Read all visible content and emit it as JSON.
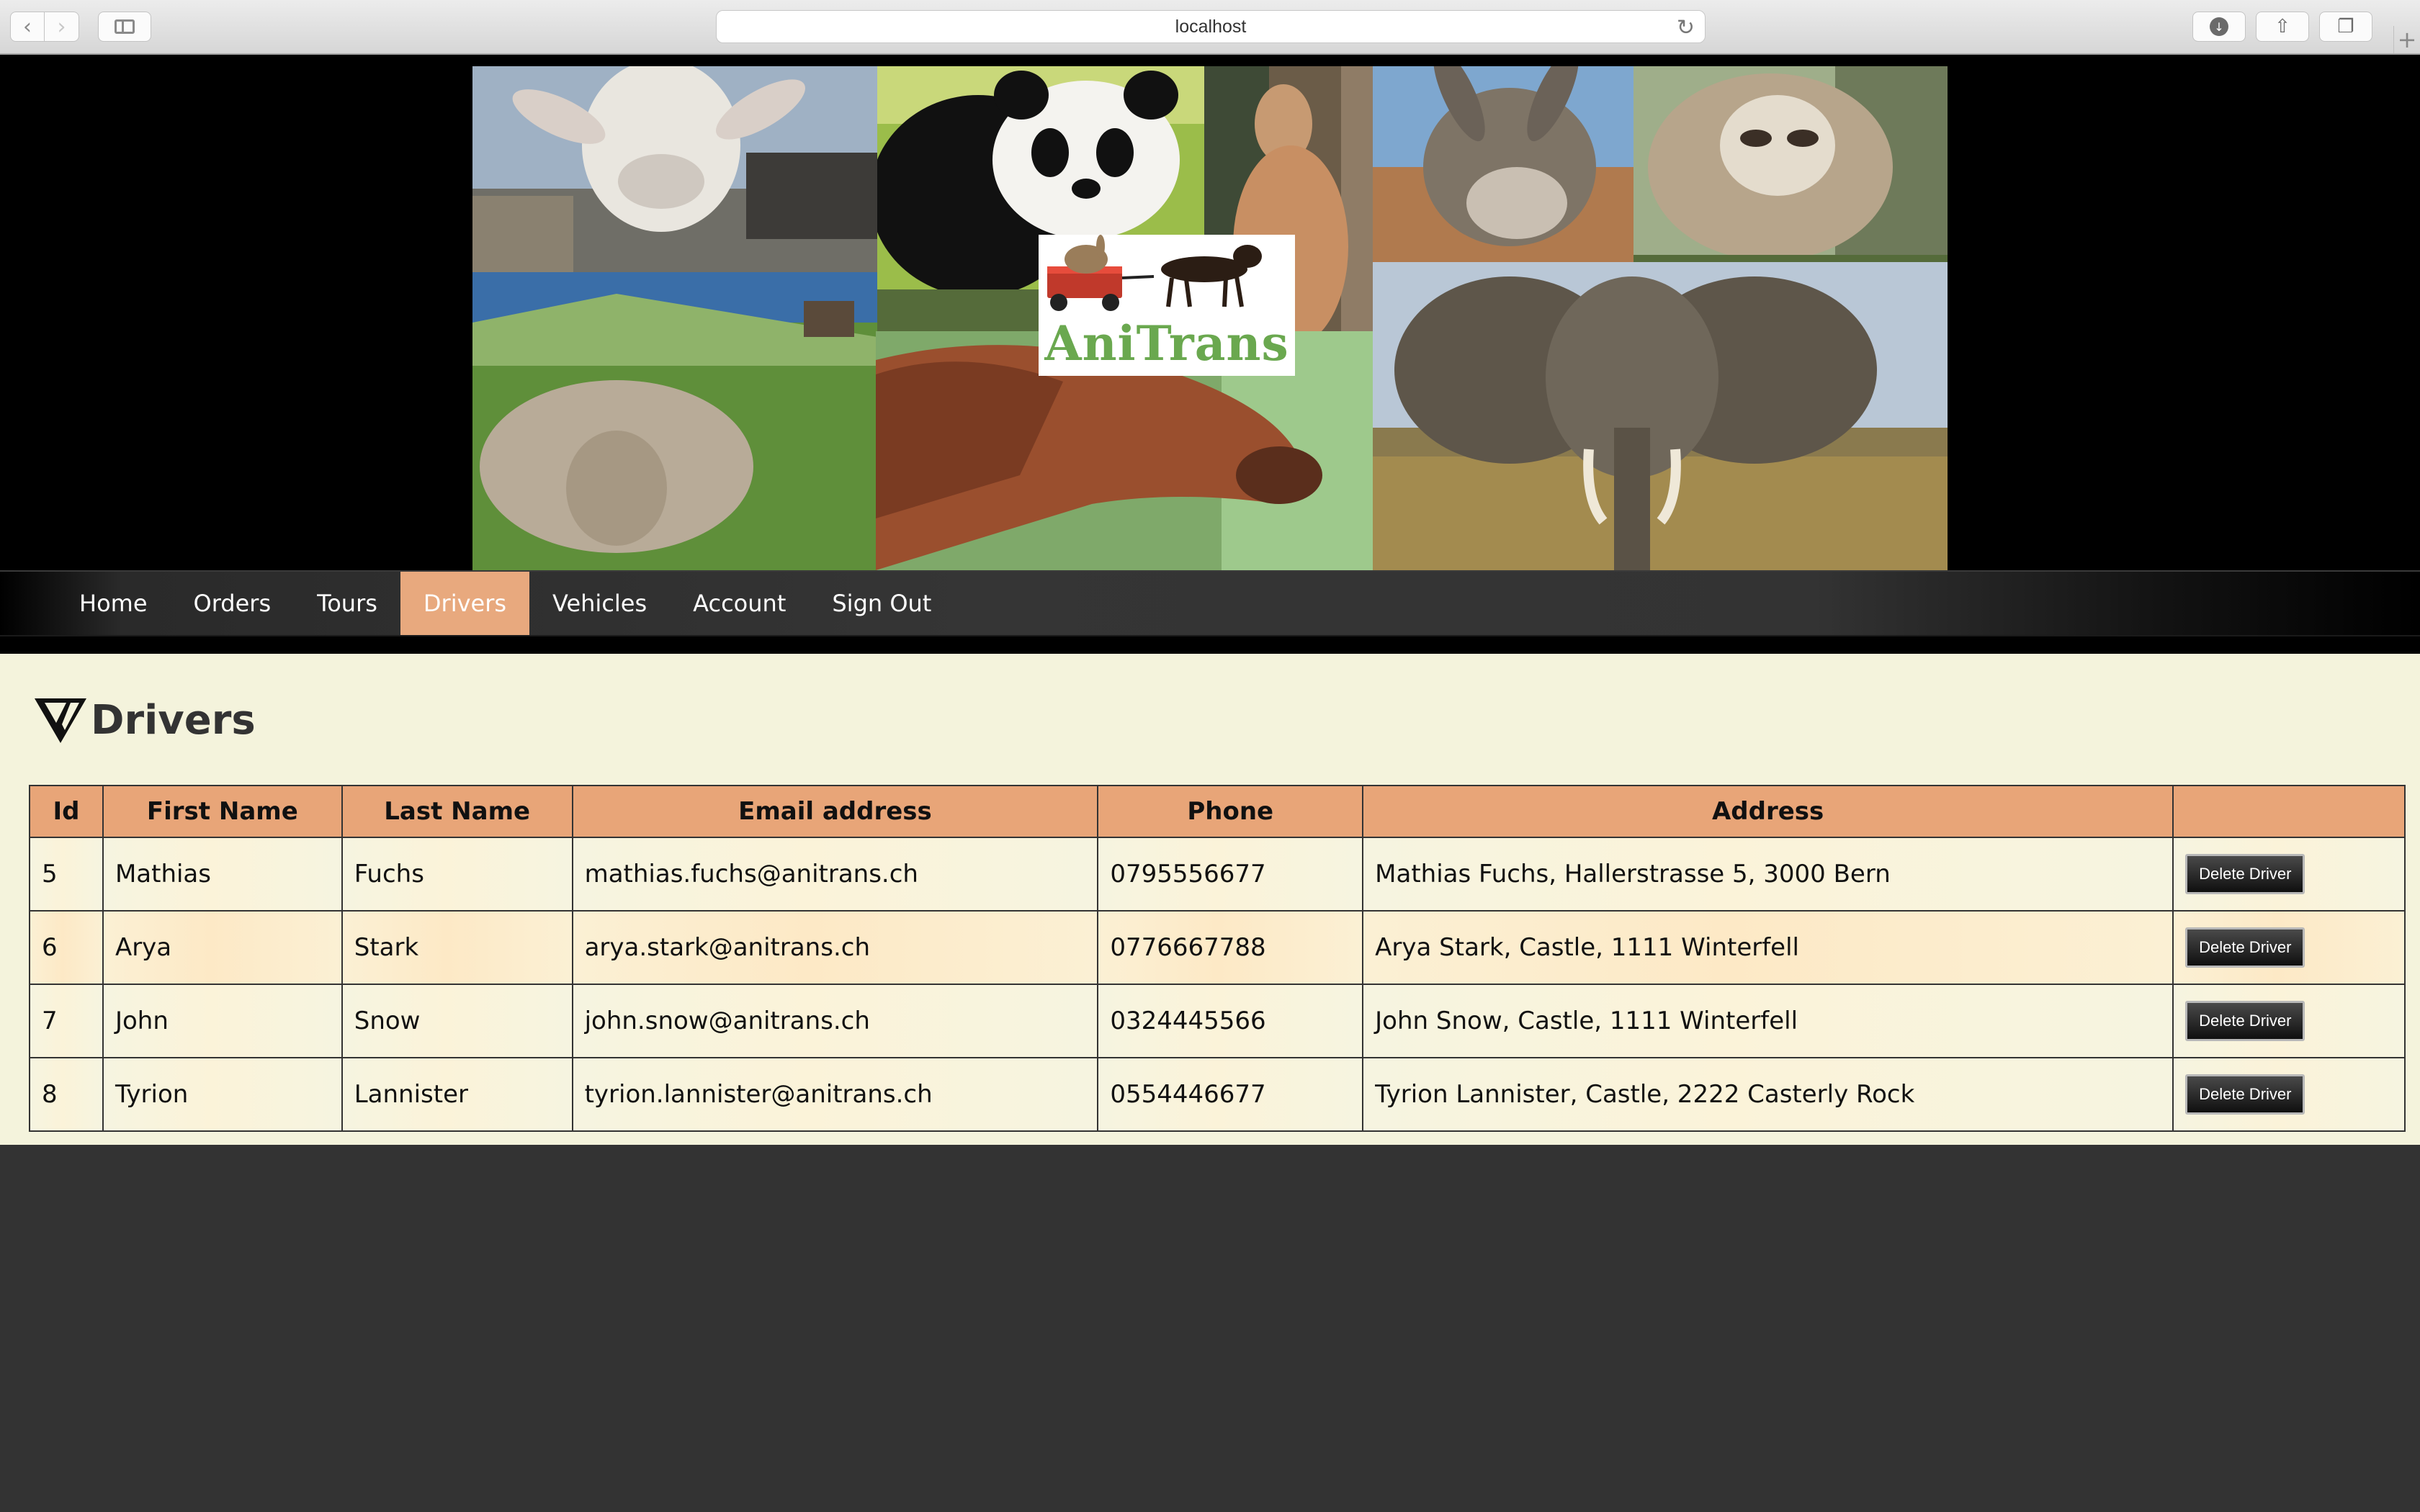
{
  "browser": {
    "url": "localhost"
  },
  "banner": {
    "logo_text": "AniTrans"
  },
  "nav": {
    "items": [
      {
        "label": "Home",
        "active": false
      },
      {
        "label": "Orders",
        "active": false
      },
      {
        "label": "Tours",
        "active": false
      },
      {
        "label": "Drivers",
        "active": true
      },
      {
        "label": "Vehicles",
        "active": false
      },
      {
        "label": "Account",
        "active": false
      },
      {
        "label": "Sign Out",
        "active": false
      }
    ]
  },
  "page": {
    "title": "Drivers"
  },
  "table": {
    "headers": [
      "Id",
      "First Name",
      "Last Name",
      "Email address",
      "Phone",
      "Address",
      ""
    ],
    "rows": [
      {
        "id": "5",
        "first": "Mathias",
        "last": "Fuchs",
        "email": "mathias.fuchs@anitrans.ch",
        "phone": "0795556677",
        "address": "Mathias Fuchs, Hallerstrasse 5, 3000 Bern",
        "action": "Delete Driver"
      },
      {
        "id": "6",
        "first": "Arya",
        "last": "Stark",
        "email": "arya.stark@anitrans.ch",
        "phone": "0776667788",
        "address": "Arya Stark, Castle, 1111 Winterfell",
        "action": "Delete Driver"
      },
      {
        "id": "7",
        "first": "John",
        "last": "Snow",
        "email": "john.snow@anitrans.ch",
        "phone": "0324445566",
        "address": "John Snow, Castle, 1111 Winterfell",
        "action": "Delete Driver"
      },
      {
        "id": "8",
        "first": "Tyrion",
        "last": "Lannister",
        "email": "tyrion.lannister@anitrans.ch",
        "phone": "0554446677",
        "address": "Tyrion Lannister, Castle, 2222 Casterly Rock",
        "action": "Delete Driver"
      }
    ]
  },
  "colors": {
    "accent": "#e8a97e",
    "header_bg": "#e8a578",
    "content_bg": "#f4f3dc",
    "logo_green": "#6aa84f"
  },
  "icons": {
    "back": "chevron-left-icon",
    "forward": "chevron-right-icon",
    "sidebar": "sidebar-icon",
    "reload": "reload-icon",
    "download": "download-icon",
    "share": "share-icon",
    "tabs": "tabs-icon",
    "new_tab": "plus-icon",
    "title": "v-logo-icon"
  }
}
